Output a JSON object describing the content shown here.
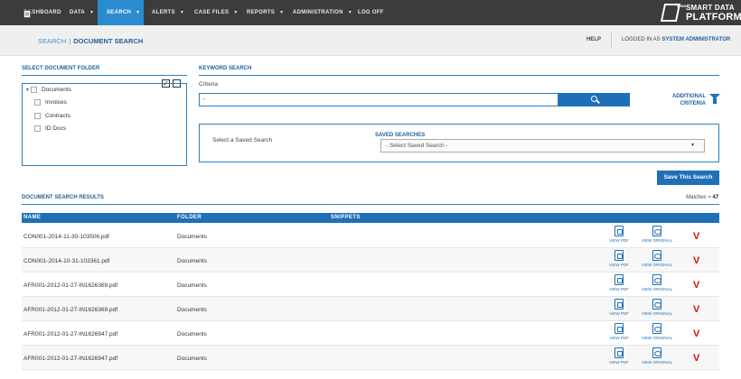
{
  "nav": {
    "items": [
      "DASHBOARD",
      "DATA",
      "SEARCH",
      "ALERTS",
      "CASE FILES",
      "REPORTS",
      "ADMINISTRATION",
      "LOG OFF"
    ],
    "active": "SEARCH",
    "accent": "#2a8bd0"
  },
  "logo": {
    "small": "WWA",
    "line1": "SMART DATA",
    "line2": "PLATFORM"
  },
  "breadcrumb": {
    "parent": "SEARCH",
    "separator": "|",
    "current": "DOCUMENT SEARCH"
  },
  "header": {
    "help": "HELP",
    "logged_prefix": "LOGGED IN AS",
    "user": "SYSTEM ADMINISTRATOR"
  },
  "folders": {
    "title": "SELECT DOCUMENT FOLDER",
    "root": "Documents",
    "children": [
      "Invoices",
      "Contracts",
      "ID Docs"
    ]
  },
  "keyword": {
    "title": "KEYWORD SEARCH",
    "criteria_label": "Criteria",
    "criteria_value": "-",
    "search_icon": "search-icon",
    "additional_line1": "ADDITIONAL",
    "additional_line2": "CRITERIA"
  },
  "saved": {
    "select_label": "Select a Saved Search",
    "title": "SAVED SEARCHES",
    "selected": "- Select Saved Search -",
    "save_button": "Save This Search"
  },
  "results": {
    "title": "DOCUMENT SEARCH RESULTS",
    "matches_label": "Matches =",
    "matches_count": "47",
    "columns": [
      "NAME",
      "FOLDER",
      "SNIPPETS"
    ],
    "view_pdf": "VIEW PDF",
    "view_original": "VIEW ORIGINAL",
    "mark": "V",
    "rows": [
      {
        "name": "CON001-2014-11-30-103506.pdf",
        "folder": "Documents"
      },
      {
        "name": "CON001-2014-10-31-103361.pdf",
        "folder": "Documents"
      },
      {
        "name": "AFR001-2012-01-27-IN1626369.pdf",
        "folder": "Documents"
      },
      {
        "name": "AFR001-2012-01-27-IN1626369.pdf",
        "folder": "Documents"
      },
      {
        "name": "AFR001-2012-01-27-IN1626947.pdf",
        "folder": "Documents"
      },
      {
        "name": "AFR001-2012-01-27-IN1626947.pdf",
        "folder": "Documents"
      }
    ]
  }
}
